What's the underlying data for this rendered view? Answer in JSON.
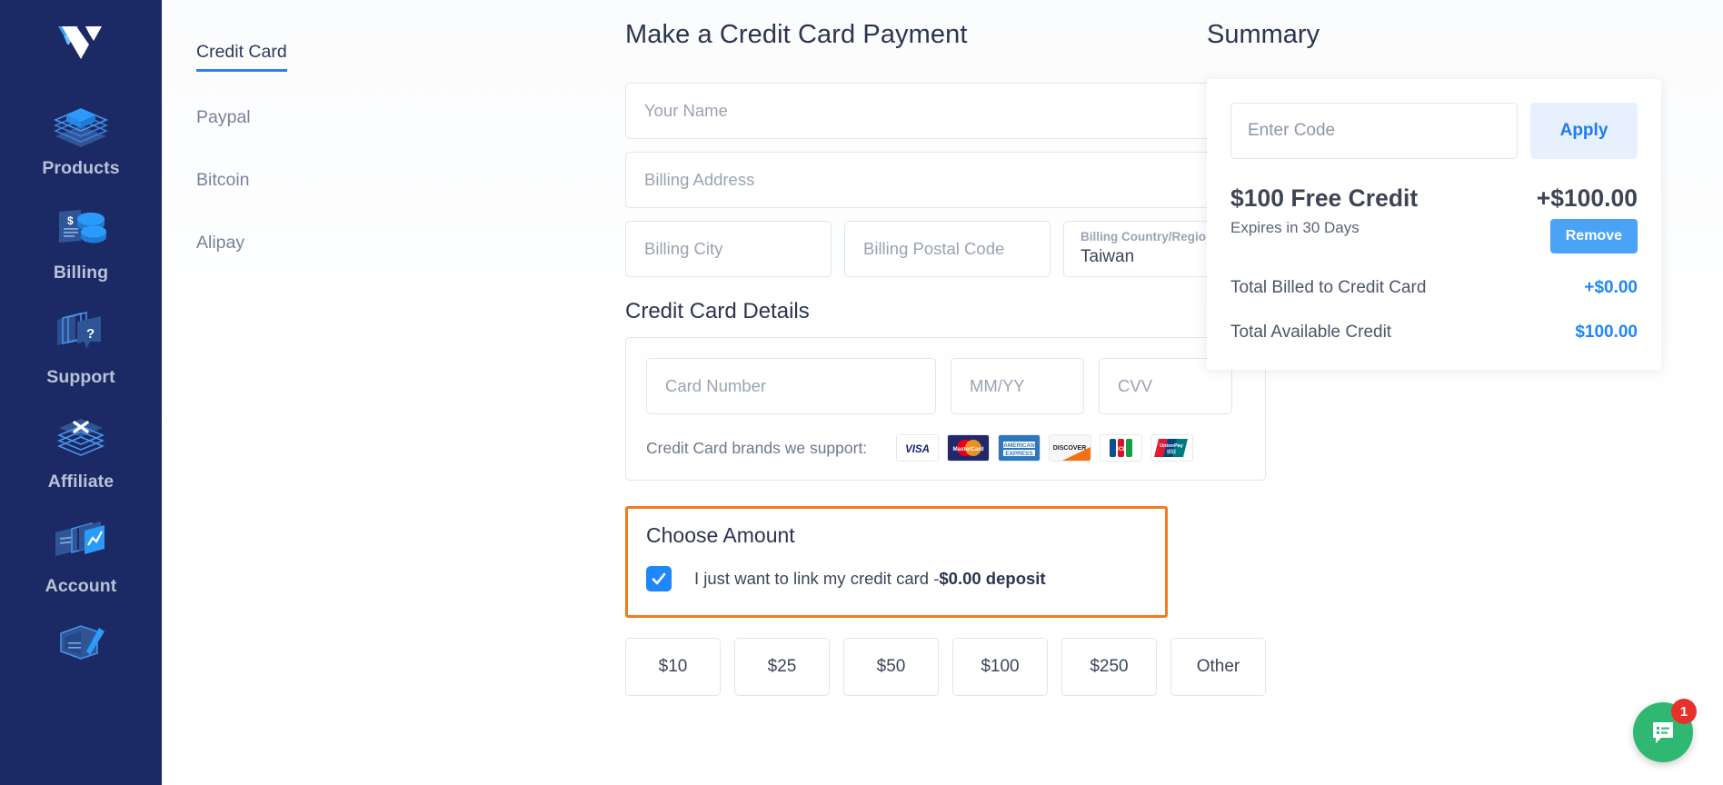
{
  "sidebar": {
    "logo_name": "vultr-logo",
    "bg_color": "#1b2a65",
    "items": [
      {
        "label": "Products",
        "icon": "layers-cube-icon"
      },
      {
        "label": "Billing",
        "icon": "invoice-coins-icon"
      },
      {
        "label": "Support",
        "icon": "question-cards-icon"
      },
      {
        "label": "Affiliate",
        "icon": "layers-x-icon"
      },
      {
        "label": "Account",
        "icon": "cards-chart-icon"
      },
      {
        "label": "",
        "icon": "book-pen-icon"
      }
    ]
  },
  "methods": {
    "items": [
      {
        "label": "Credit Card",
        "active": true
      },
      {
        "label": "Paypal",
        "active": false
      },
      {
        "label": "Bitcoin",
        "active": false
      },
      {
        "label": "Alipay",
        "active": false
      }
    ]
  },
  "form": {
    "title": "Make a Credit Card Payment",
    "name_placeholder": "Your Name",
    "address_placeholder": "Billing Address",
    "city_placeholder": "Billing City",
    "postal_placeholder": "Billing Postal Code",
    "country_label": "Billing Country/Region",
    "country_value": "Taiwan",
    "card_section_title": "Credit Card Details",
    "card_number_placeholder": "Card Number",
    "expiry_placeholder": "MM/YY",
    "cvv_placeholder": "CVV",
    "brands_label": "Credit Card brands we support:",
    "brands": [
      "VISA",
      "MasterCard",
      "AMERICAN EXPRESS",
      "DISCOVER",
      "JCB",
      "UnionPay"
    ]
  },
  "choose_amount": {
    "title": "Choose Amount",
    "highlight_color": "#f47a20",
    "checkbox_checked": true,
    "checkbox_text": "I just want to link my credit card -",
    "checkbox_text_bold": "$0.00 deposit",
    "amounts": [
      "$10",
      "$25",
      "$50",
      "$100",
      "$250",
      "Other"
    ]
  },
  "summary": {
    "title": "Summary",
    "code_placeholder": "Enter Code",
    "apply_label": "Apply",
    "credit_name": "$100 Free Credit",
    "credit_amount": "+$100.00",
    "credit_expiry": "Expires in 30 Days",
    "remove_label": "Remove",
    "totals": [
      {
        "label": "Total Billed to Credit Card",
        "value": "+$0.00"
      },
      {
        "label": "Total Available Credit",
        "value": "$100.00"
      }
    ],
    "accent_color": "#1f86fb"
  },
  "chat": {
    "badge_count": "1",
    "color": "#2fb871",
    "icon": "chat-bubble-icon"
  }
}
